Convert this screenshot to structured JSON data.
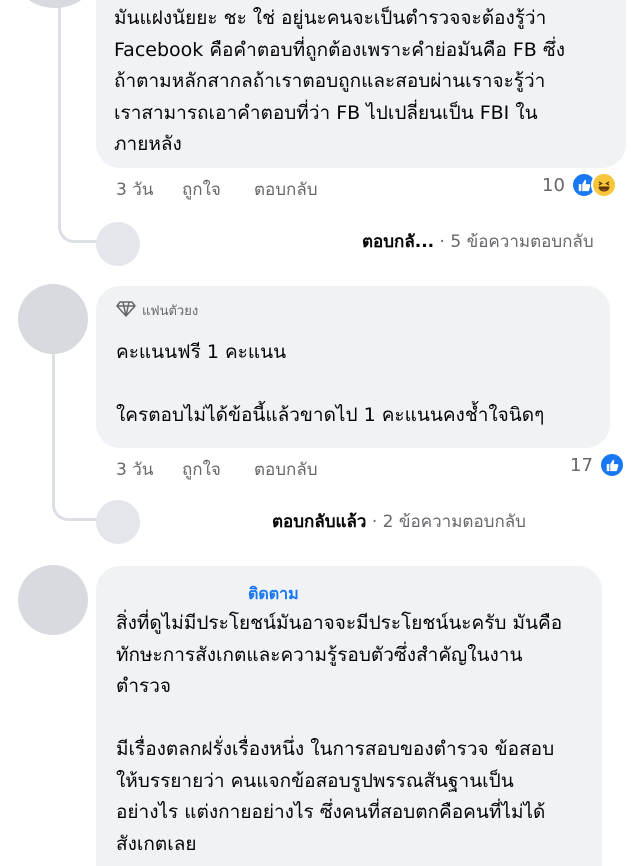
{
  "comments": [
    {
      "text": "มันแฝงนัยยะ ชะ ใช่ อยู่นะคนจะเป็นตำรวจจะต้องรู้ว่า\nFacebook คือคำตอบที่ถูกต้องเพราะคำย่อมันคือ FB ซึ่ง\nถ้าตามหลักสากลถ้าเราตอบถูกและสอบผ่านเราจะรู้ว่า\nเราสามารถเอาคำตอบที่ว่า FB ไปเปลี่ยนเป็น FBI ใน\nภายหลัง",
      "time": "3 วัน",
      "like_label": "ถูกใจ",
      "reply_label": "ตอบกลับ",
      "reaction_count": "10",
      "reactions": [
        "like-icon",
        "haha-icon"
      ],
      "view_replies_name": "ตอบกลั...",
      "view_replies_count": "· 5 ข้อความตอบกลับ"
    },
    {
      "badge": "แฟนตัวยง",
      "badge_icon": "diamond-icon",
      "text": "คะแนนฟรี 1 คะแนน\n\nใครตอบไม่ได้ข้อนี้แล้วขาดไป 1 คะแนนคงช้ำใจนิดๆ",
      "time": "3 วัน",
      "like_label": "ถูกใจ",
      "reply_label": "ตอบกลับ",
      "reaction_count": "17",
      "reactions": [
        "like-icon"
      ],
      "view_replies_name": "ตอบกลับแล้ว",
      "view_replies_count": "· 2 ข้อความตอบกลับ"
    },
    {
      "follow_label": "ติดตาม",
      "text": "สิ่งที่ดูไม่มีประโยชน์มันอาจจะมีประโยชน์นะครับ มันคือ\nทักษะการสังเกตและความรู้รอบตัวซึ่งสำคัญในงาน\nตำรวจ\n\nมีเรื่องตลกฝรั่งเรื่องหนึ่ง ในการสอบของตำรวจ ข้อสอบ\nให้บรรยายว่า คนแจกข้อสอบรูปพรรณสันฐานเป็น\nอย่างไร แต่งกายอย่างไร ซึ่งคนที่สอบตกคือคนที่ไม่ได้\nสังเกตเลย"
    }
  ],
  "colors": {
    "bubble": "#f0f2f5",
    "meta": "#65676b",
    "like_blue": "#1877f2",
    "haha_yellow": "#f7c63a",
    "follow_blue": "#1877f2"
  }
}
